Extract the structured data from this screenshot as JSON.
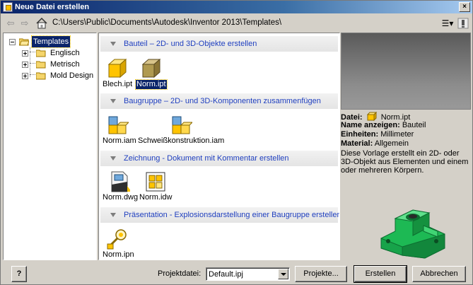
{
  "window": {
    "title": "Neue Datei erstellen",
    "close_label": "×"
  },
  "address": {
    "back_label": "⇦",
    "forward_label": "⇨",
    "path": "C:\\Users\\Public\\Documents\\Autodesk\\Inventor 2013\\Templates\\",
    "view_label": "☰▾"
  },
  "tree": {
    "root": "Templates",
    "items": [
      "Englisch",
      "Metrisch",
      "Mold Design"
    ]
  },
  "sections": [
    {
      "title": "Bauteil – 2D- und 3D-Objekte erstellen",
      "files": [
        "Blech.ipt",
        "Norm.ipt"
      ]
    },
    {
      "title": "Baugruppe – 2D- und 3D-Komponenten zusammenfügen",
      "files": [
        "Norm.iam",
        "Schweißkonstruktion.iam"
      ]
    },
    {
      "title": "Zeichnung - Dokument mit Kommentar erstellen",
      "files": [
        "Norm.dwg",
        "Norm.idw"
      ]
    },
    {
      "title": "Präsentation - Explosionsdarstellung einer Baugruppe erstellen",
      "files": [
        "Norm.ipn"
      ]
    }
  ],
  "info": {
    "file_label": "Datei:",
    "file_value": "Norm.ipt",
    "display_label": "Name anzeigen:",
    "display_value": "Bauteil",
    "units_label": "Einheiten:",
    "units_value": "Millimeter",
    "material_label": "Material:",
    "material_value": "Allgemein",
    "description": "Diese Vorlage erstellt ein 2D- oder 3D-Objekt aus Elementen und einem oder mehreren Körpern."
  },
  "footer": {
    "help_label": "?",
    "project_label": "Projektdatei:",
    "project_value": "Default.ipj",
    "projects_button": "Projekte...",
    "create_button": "Erstellen",
    "cancel_button": "Abbrechen"
  },
  "colors": {
    "title_bar": "#0a246a",
    "selection": "#0a246a",
    "section_text": "#1f3fbf",
    "part_green": "#1db954"
  }
}
